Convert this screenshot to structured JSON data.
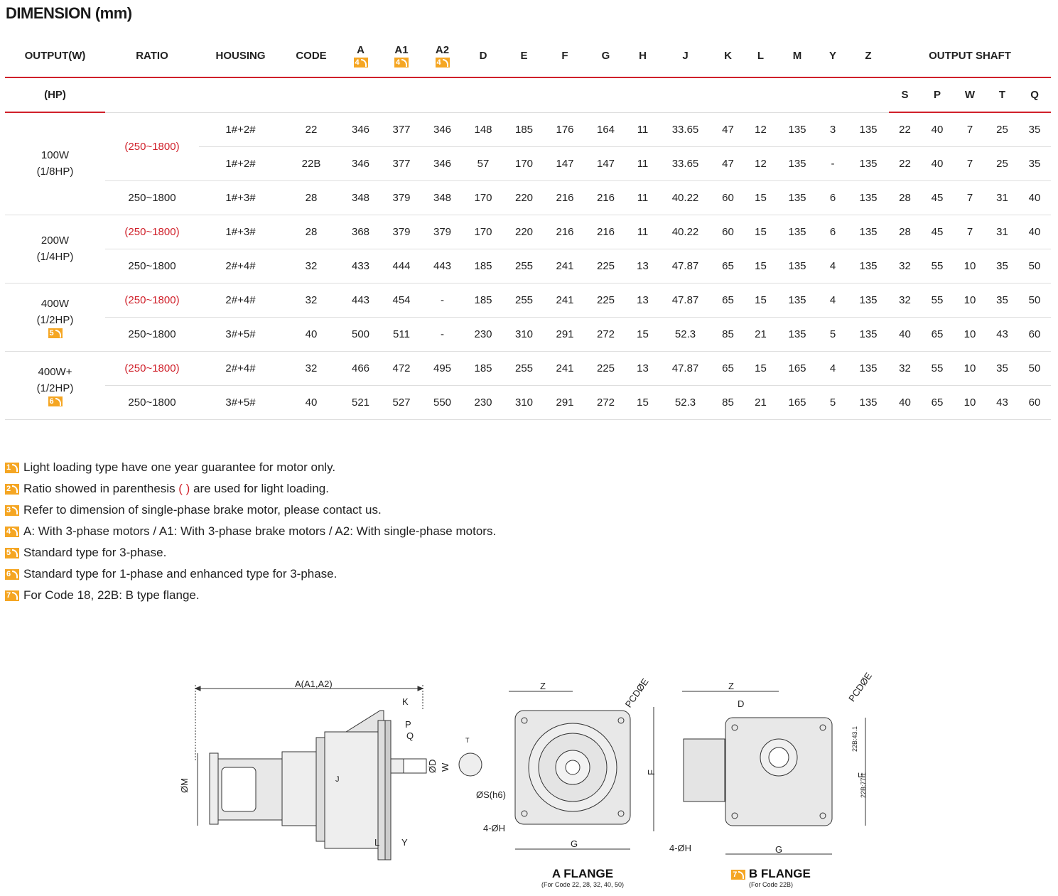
{
  "title": "DIMENSION",
  "title_unit": "(mm)",
  "headers": {
    "output": "OUTPUT(W)",
    "output_hp": "(HP)",
    "ratio": "RATIO",
    "housing": "HOUSING",
    "code": "CODE",
    "a": "A",
    "a1": "A1",
    "a2": "A2",
    "a_badge": "4",
    "a1_badge": "4",
    "a2_badge": "4",
    "d": "D",
    "e": "E",
    "f": "F",
    "g": "G",
    "h": "H",
    "j": "J",
    "k": "K",
    "l": "L",
    "m": "M",
    "y": "Y",
    "z": "Z",
    "output_shaft": "OUTPUT SHAFT",
    "s": "S",
    "p": "P",
    "w": "W",
    "t": "T",
    "q": "Q"
  },
  "groups": [
    {
      "watt": "100W",
      "hp": "(1/8HP)",
      "badge": "",
      "ratio_top": "(250~1800)"
    },
    {
      "watt": "200W",
      "hp": "(1/4HP)",
      "badge": ""
    },
    {
      "watt": "400W",
      "hp": "(1/2HP)",
      "badge": "5"
    },
    {
      "watt": "400W+",
      "hp": "(1/2HP)",
      "badge": "6"
    }
  ],
  "rows": [
    {
      "ratio": "",
      "housing": "1#+2#",
      "code": "22",
      "a": "346",
      "a1": "377",
      "a2": "346",
      "d": "148",
      "e": "185",
      "f": "176",
      "g": "164",
      "h": "11",
      "j": "33.65",
      "k": "47",
      "l": "12",
      "m": "135",
      "y": "3",
      "z": "135",
      "s": "22",
      "p": "40",
      "w": "7",
      "t": "25",
      "q": "35"
    },
    {
      "ratio": "",
      "housing": "1#+2#",
      "code": "22B",
      "a": "346",
      "a1": "377",
      "a2": "346",
      "d": "57",
      "e": "170",
      "f": "147",
      "g": "147",
      "h": "11",
      "j": "33.65",
      "k": "47",
      "l": "12",
      "m": "135",
      "y": "-",
      "z": "135",
      "s": "22",
      "p": "40",
      "w": "7",
      "t": "25",
      "q": "35"
    },
    {
      "ratio": "250~1800",
      "housing": "1#+3#",
      "code": "28",
      "a": "348",
      "a1": "379",
      "a2": "348",
      "d": "170",
      "e": "220",
      "f": "216",
      "g": "216",
      "h": "11",
      "j": "40.22",
      "k": "60",
      "l": "15",
      "m": "135",
      "y": "6",
      "z": "135",
      "s": "28",
      "p": "45",
      "w": "7",
      "t": "31",
      "q": "40"
    },
    {
      "ratio": "(250~1800)",
      "housing": "1#+3#",
      "code": "28",
      "a": "368",
      "a1": "379",
      "a2": "379",
      "d": "170",
      "e": "220",
      "f": "216",
      "g": "216",
      "h": "11",
      "j": "40.22",
      "k": "60",
      "l": "15",
      "m": "135",
      "y": "6",
      "z": "135",
      "s": "28",
      "p": "45",
      "w": "7",
      "t": "31",
      "q": "40"
    },
    {
      "ratio": "250~1800",
      "housing": "2#+4#",
      "code": "32",
      "a": "433",
      "a1": "444",
      "a2": "443",
      "d": "185",
      "e": "255",
      "f": "241",
      "g": "225",
      "h": "13",
      "j": "47.87",
      "k": "65",
      "l": "15",
      "m": "135",
      "y": "4",
      "z": "135",
      "s": "32",
      "p": "55",
      "w": "10",
      "t": "35",
      "q": "50"
    },
    {
      "ratio": "(250~1800)",
      "housing": "2#+4#",
      "code": "32",
      "a": "443",
      "a1": "454",
      "a2": "-",
      "d": "185",
      "e": "255",
      "f": "241",
      "g": "225",
      "h": "13",
      "j": "47.87",
      "k": "65",
      "l": "15",
      "m": "135",
      "y": "4",
      "z": "135",
      "s": "32",
      "p": "55",
      "w": "10",
      "t": "35",
      "q": "50"
    },
    {
      "ratio": "250~1800",
      "housing": "3#+5#",
      "code": "40",
      "a": "500",
      "a1": "511",
      "a2": "-",
      "d": "230",
      "e": "310",
      "f": "291",
      "g": "272",
      "h": "15",
      "j": "52.3",
      "k": "85",
      "l": "21",
      "m": "135",
      "y": "5",
      "z": "135",
      "s": "40",
      "p": "65",
      "w": "10",
      "t": "43",
      "q": "60"
    },
    {
      "ratio": "(250~1800)",
      "housing": "2#+4#",
      "code": "32",
      "a": "466",
      "a1": "472",
      "a2": "495",
      "d": "185",
      "e": "255",
      "f": "241",
      "g": "225",
      "h": "13",
      "j": "47.87",
      "k": "65",
      "l": "15",
      "m": "165",
      "y": "4",
      "z": "135",
      "s": "32",
      "p": "55",
      "w": "10",
      "t": "35",
      "q": "50"
    },
    {
      "ratio": "250~1800",
      "housing": "3#+5#",
      "code": "40",
      "a": "521",
      "a1": "527",
      "a2": "550",
      "d": "230",
      "e": "310",
      "f": "291",
      "g": "272",
      "h": "15",
      "j": "52.3",
      "k": "85",
      "l": "21",
      "m": "165",
      "y": "5",
      "z": "135",
      "s": "40",
      "p": "65",
      "w": "10",
      "t": "43",
      "q": "60"
    }
  ],
  "notes": [
    {
      "num": "1",
      "text": "Light loading type have one year guarantee for motor only."
    },
    {
      "num": "2",
      "text_before": "Ratio showed in parenthesis ",
      "text_red": "( )",
      "text_after": " are used for light loading."
    },
    {
      "num": "3",
      "text": "Refer to dimension of single-phase brake motor, please contact us."
    },
    {
      "num": "4",
      "text": "A: With 3-phase motors / A1: With 3-phase brake motors / A2: With single-phase motors."
    },
    {
      "num": "5",
      "text": "Standard type for 3-phase."
    },
    {
      "num": "6",
      "text": "Standard type for 1-phase and enhanced type for 3-phase."
    },
    {
      "num": "7",
      "text": "For Code 18, 22B: B type flange."
    }
  ],
  "drawing_labels": {
    "a_dim": "A(A1,A2)",
    "k": "K",
    "p": "P",
    "q": "Q",
    "od": "ØD",
    "w": "W",
    "t": "T",
    "os": "ØS(h6)",
    "om": "ØM",
    "j": "J",
    "l": "L",
    "y": "Y",
    "z": "Z",
    "pcd": "PCDØE",
    "f": "F",
    "g": "G",
    "fourh": "4-ØH",
    "d": "D",
    "b_22b_top": "22B:43.1",
    "b_22b_bottom": "22B:77.1"
  },
  "captions": {
    "a_flange": "A FLANGE",
    "a_flange_sub": "(For Code 22, 28, 32, 40, 50)",
    "b_flange_badge": "7",
    "b_flange": "B FLANGE",
    "b_flange_sub": "(For Code 22B)"
  },
  "colors": {
    "accent_red": "#d0202a",
    "badge_orange": "#f5a623"
  }
}
